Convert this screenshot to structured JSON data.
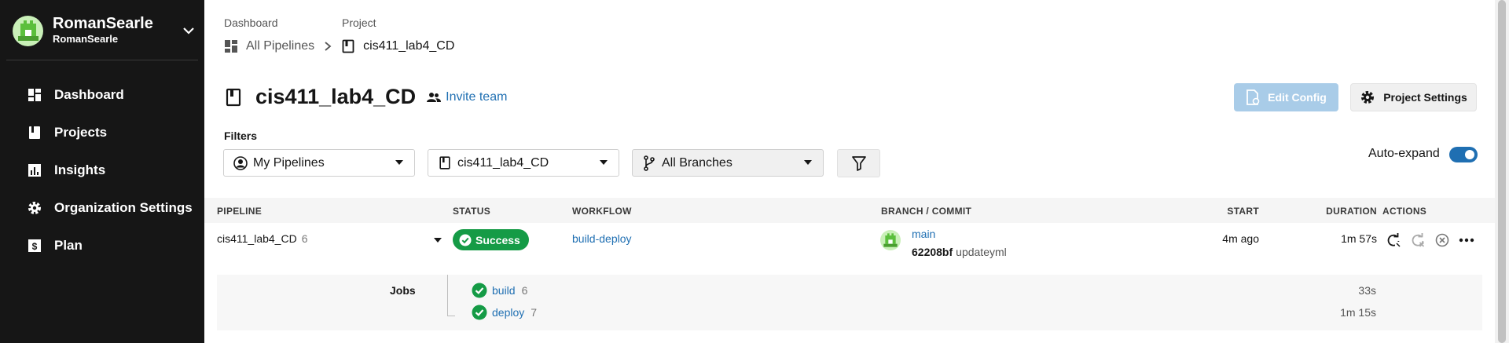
{
  "sidebar": {
    "org_name": "RomanSearle",
    "org_sub": "RomanSearle",
    "items": [
      {
        "label": "Dashboard",
        "icon": "dashboard-icon"
      },
      {
        "label": "Projects",
        "icon": "book-icon"
      },
      {
        "label": "Insights",
        "icon": "chart-icon"
      },
      {
        "label": "Organization Settings",
        "icon": "gear-icon"
      },
      {
        "label": "Plan",
        "icon": "dollar-icon"
      }
    ]
  },
  "breadcrumb": {
    "level1_label": "Dashboard",
    "level2_label": "Project",
    "level1_value": "All Pipelines",
    "level2_value": "cis411_lab4_CD"
  },
  "header": {
    "title": "cis411_lab4_CD",
    "invite": "Invite team",
    "edit_config": "Edit Config",
    "project_settings": "Project Settings"
  },
  "filters": {
    "label": "Filters",
    "pipelines": "My Pipelines",
    "project": "cis411_lab4_CD",
    "branches": "All Branches",
    "auto_expand_label": "Auto-expand",
    "auto_expand_on": true
  },
  "table": {
    "headers": {
      "pipeline": "PIPELINE",
      "status": "STATUS",
      "workflow": "WORKFLOW",
      "branch_commit": "BRANCH / COMMIT",
      "start": "START",
      "duration": "DURATION",
      "actions": "ACTIONS"
    },
    "row": {
      "pipeline": "cis411_lab4_CD",
      "number": "6",
      "status": "Success",
      "workflow": "build-deploy",
      "branch": "main",
      "commit_sha": "62208bf",
      "commit_msg": "updateyml",
      "start": "4m ago",
      "duration": "1m 57s"
    },
    "jobs_label": "Jobs",
    "jobs": [
      {
        "name": "build",
        "number": "6",
        "duration": "33s"
      },
      {
        "name": "deploy",
        "number": "7",
        "duration": "1m 15s"
      }
    ]
  },
  "colors": {
    "sidebar_bg": "#161616",
    "link": "#1f6fb2",
    "success": "#159b46",
    "edit_config_bg": "#a9cce8"
  }
}
